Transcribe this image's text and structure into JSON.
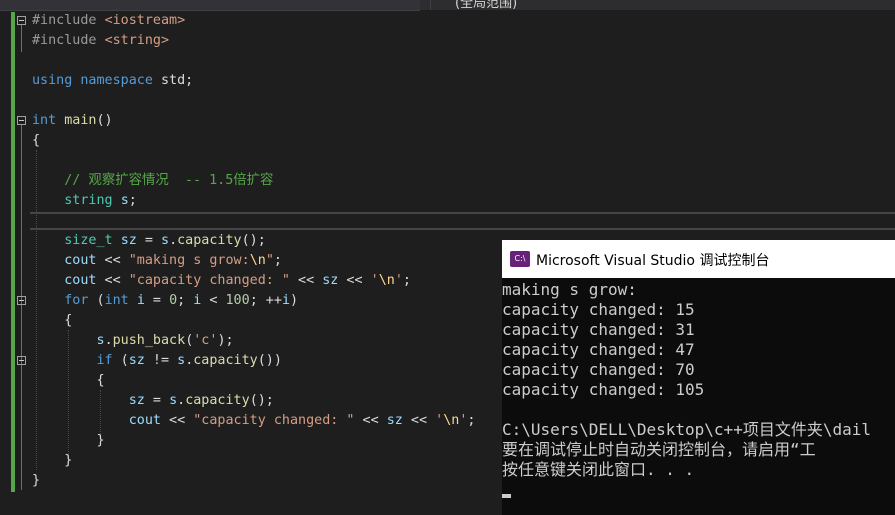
{
  "top_bar": {
    "scope_label": "(全局范围)"
  },
  "editor": {
    "lines": [
      {
        "segments": [
          [
            "pp",
            "#include "
          ],
          [
            "inc",
            "<iostream>"
          ]
        ]
      },
      {
        "segments": [
          [
            "pp",
            "#include "
          ],
          [
            "inc",
            "<string>"
          ]
        ]
      },
      {
        "segments": []
      },
      {
        "segments": [
          [
            "kw",
            "using"
          ],
          [
            "",
            " "
          ],
          [
            "kw",
            "namespace"
          ],
          [
            "",
            " std;"
          ]
        ]
      },
      {
        "segments": []
      },
      {
        "segments": [
          [
            "kw",
            "int"
          ],
          [
            "",
            " "
          ],
          [
            "fn",
            "main"
          ],
          [
            "",
            "()"
          ]
        ]
      },
      {
        "segments": [
          [
            "",
            "{"
          ]
        ]
      },
      {
        "segments": []
      },
      {
        "segments": [
          [
            "",
            "    "
          ],
          [
            "cm",
            "// 观察扩容情况  -- 1.5倍扩容"
          ]
        ]
      },
      {
        "segments": [
          [
            "",
            "    "
          ],
          [
            "ty",
            "string"
          ],
          [
            "",
            " "
          ],
          [
            "vr",
            "s"
          ],
          [
            "",
            ";"
          ]
        ]
      },
      {
        "segments": []
      },
      {
        "segments": [
          [
            "",
            "    "
          ],
          [
            "ty",
            "size_t"
          ],
          [
            "",
            " "
          ],
          [
            "vr",
            "sz"
          ],
          [
            "",
            " = "
          ],
          [
            "vr",
            "s"
          ],
          [
            "",
            "."
          ],
          [
            "fn",
            "capacity"
          ],
          [
            "",
            "();"
          ]
        ]
      },
      {
        "segments": [
          [
            "",
            "    "
          ],
          [
            "vr",
            "cout"
          ],
          [
            "",
            " << "
          ],
          [
            "str",
            "\"making s grow:"
          ],
          [
            "esc",
            "\\n"
          ],
          [
            "str",
            "\""
          ],
          [
            "",
            ";"
          ]
        ]
      },
      {
        "segments": [
          [
            "",
            "    "
          ],
          [
            "vr",
            "cout"
          ],
          [
            "",
            " << "
          ],
          [
            "str",
            "\"capacity changed: \""
          ],
          [
            "",
            " << "
          ],
          [
            "vr",
            "sz"
          ],
          [
            "",
            " << "
          ],
          [
            "str",
            "'"
          ],
          [
            "esc",
            "\\n"
          ],
          [
            "str",
            "'"
          ],
          [
            "",
            ";"
          ]
        ]
      },
      {
        "segments": [
          [
            "",
            "    "
          ],
          [
            "kw",
            "for"
          ],
          [
            "",
            " ("
          ],
          [
            "kw",
            "int"
          ],
          [
            "",
            " "
          ],
          [
            "vr",
            "i"
          ],
          [
            "",
            " = "
          ],
          [
            "num",
            "0"
          ],
          [
            "",
            "; "
          ],
          [
            "vr",
            "i"
          ],
          [
            "",
            " < "
          ],
          [
            "num",
            "100"
          ],
          [
            "",
            "; ++"
          ],
          [
            "vr",
            "i"
          ],
          [
            "",
            ")"
          ]
        ]
      },
      {
        "segments": [
          [
            "",
            "    {"
          ]
        ]
      },
      {
        "segments": [
          [
            "",
            "        "
          ],
          [
            "vr",
            "s"
          ],
          [
            "",
            "."
          ],
          [
            "fn",
            "push_back"
          ],
          [
            "",
            "("
          ],
          [
            "str",
            "'c'"
          ],
          [
            "",
            ");"
          ]
        ]
      },
      {
        "segments": [
          [
            "",
            "        "
          ],
          [
            "kw",
            "if"
          ],
          [
            "",
            " ("
          ],
          [
            "vr",
            "sz"
          ],
          [
            "",
            " != "
          ],
          [
            "vr",
            "s"
          ],
          [
            "",
            "."
          ],
          [
            "fn",
            "capacity"
          ],
          [
            "",
            "())"
          ]
        ]
      },
      {
        "segments": [
          [
            "",
            "        {"
          ]
        ]
      },
      {
        "segments": [
          [
            "",
            "            "
          ],
          [
            "vr",
            "sz"
          ],
          [
            "",
            " = "
          ],
          [
            "vr",
            "s"
          ],
          [
            "",
            "."
          ],
          [
            "fn",
            "capacity"
          ],
          [
            "",
            "();"
          ]
        ]
      },
      {
        "segments": [
          [
            "",
            "            "
          ],
          [
            "vr",
            "cout"
          ],
          [
            "",
            " << "
          ],
          [
            "str",
            "\"capacity changed: \""
          ],
          [
            "",
            " << "
          ],
          [
            "vr",
            "sz"
          ],
          [
            "",
            " << "
          ],
          [
            "str",
            "'"
          ],
          [
            "esc",
            "\\n"
          ],
          [
            "str",
            "'"
          ],
          [
            "",
            ";"
          ]
        ]
      },
      {
        "segments": [
          [
            "",
            "        }"
          ]
        ]
      },
      {
        "segments": [
          [
            "",
            "    }"
          ]
        ]
      },
      {
        "segments": [
          [
            "",
            "}"
          ]
        ]
      }
    ]
  },
  "console": {
    "icon_text": "C:\\",
    "title": "Microsoft Visual Studio 调试控制台",
    "output_lines": [
      "making s grow:",
      "capacity changed: 15",
      "capacity changed: 31",
      "capacity changed: 47",
      "capacity changed: 70",
      "capacity changed: 105",
      "",
      "C:\\Users\\DELL\\Desktop\\c++项目文件夹\\dail",
      "要在调试停止时自动关闭控制台，请启用“工",
      "按任意键关闭此窗口. . ."
    ]
  }
}
